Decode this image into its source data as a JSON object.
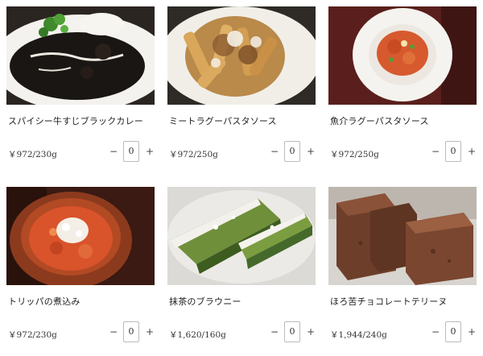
{
  "products": [
    {
      "name": "スパイシー牛すじブラックカレー",
      "price": "￥972/230g",
      "qty": "0",
      "photo": "black-curry"
    },
    {
      "name": "ミートラグーパスタソース",
      "price": "￥972/250g",
      "qty": "0",
      "photo": "meat-ragu-pasta"
    },
    {
      "name": "魚介ラグーパスタソース",
      "price": "￥972/250g",
      "qty": "0",
      "photo": "seafood-ragu-pasta"
    },
    {
      "name": "トリッパの煮込み",
      "price": "￥972/230g",
      "qty": "0",
      "photo": "trippa-stew"
    },
    {
      "name": "抹茶のブラウニー",
      "price": "￥1,620/160g",
      "qty": "0",
      "photo": "matcha-brownie"
    },
    {
      "name": "ほろ苦チョコレートテリーヌ",
      "price": "￥1,944/240g",
      "qty": "0",
      "photo": "chocolate-terrine"
    }
  ],
  "controls": {
    "minus_label": "−",
    "plus_label": "+"
  },
  "colors": {
    "text": "#222222",
    "border": "#bbbbbb",
    "background": "#ffffff"
  }
}
